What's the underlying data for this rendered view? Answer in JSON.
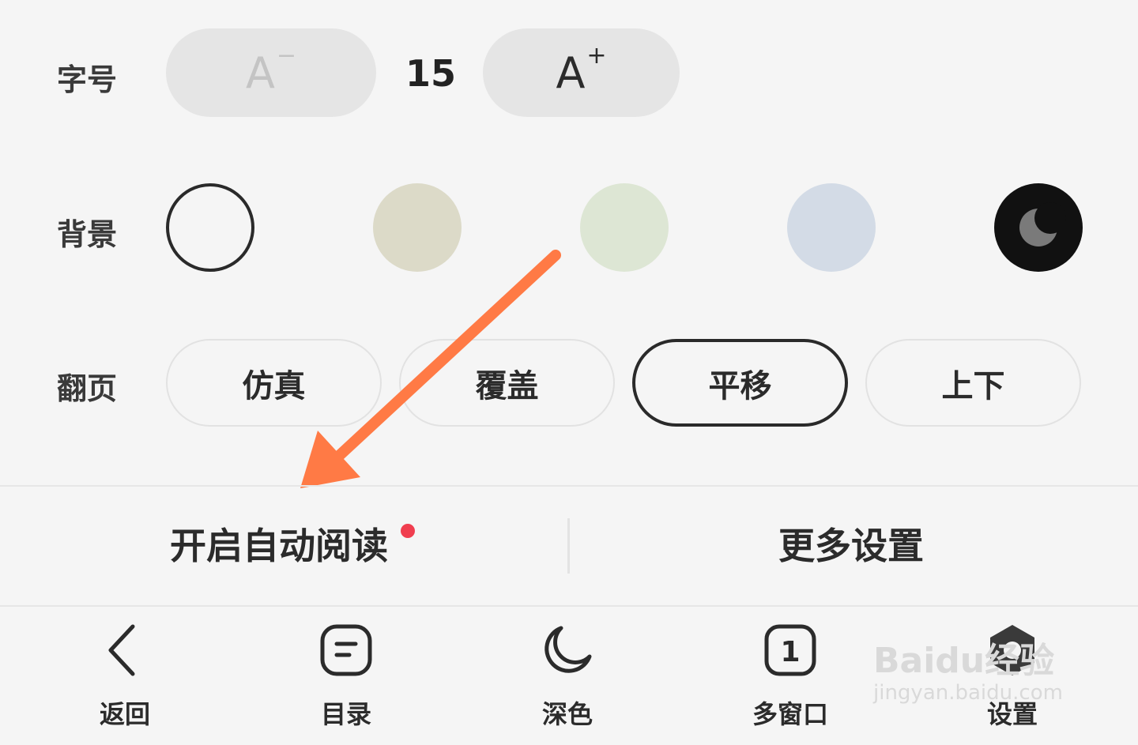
{
  "font_size": {
    "label": "字号",
    "decrease_label": "A",
    "decrease_sup": "−",
    "value": "15",
    "increase_label": "A",
    "increase_sup": "+"
  },
  "background": {
    "label": "背景",
    "swatches": [
      {
        "name": "white",
        "color": "#f5f5f5",
        "selected": true
      },
      {
        "name": "beige",
        "color": "#dcdac8",
        "selected": false
      },
      {
        "name": "green",
        "color": "#dde6d4",
        "selected": false
      },
      {
        "name": "blue",
        "color": "#d3dbe6",
        "selected": false
      },
      {
        "name": "dark",
        "color": "#111111",
        "selected": false
      }
    ]
  },
  "page_turn": {
    "label": "翻页",
    "options": [
      "仿真",
      "覆盖",
      "平移",
      "上下"
    ],
    "selected": "平移"
  },
  "actions": {
    "auto_read": "开启自动阅读",
    "more_settings": "更多设置"
  },
  "bottom_nav": {
    "back": "返回",
    "toc": "目录",
    "dark": "深色",
    "multi_window": "多窗口",
    "settings": "设置"
  },
  "watermark": {
    "brand": "Baidu经验",
    "url": "jingyan.baidu.com"
  },
  "colors": {
    "accent_arrow": "#ff7a45",
    "badge": "#f03e4f"
  }
}
